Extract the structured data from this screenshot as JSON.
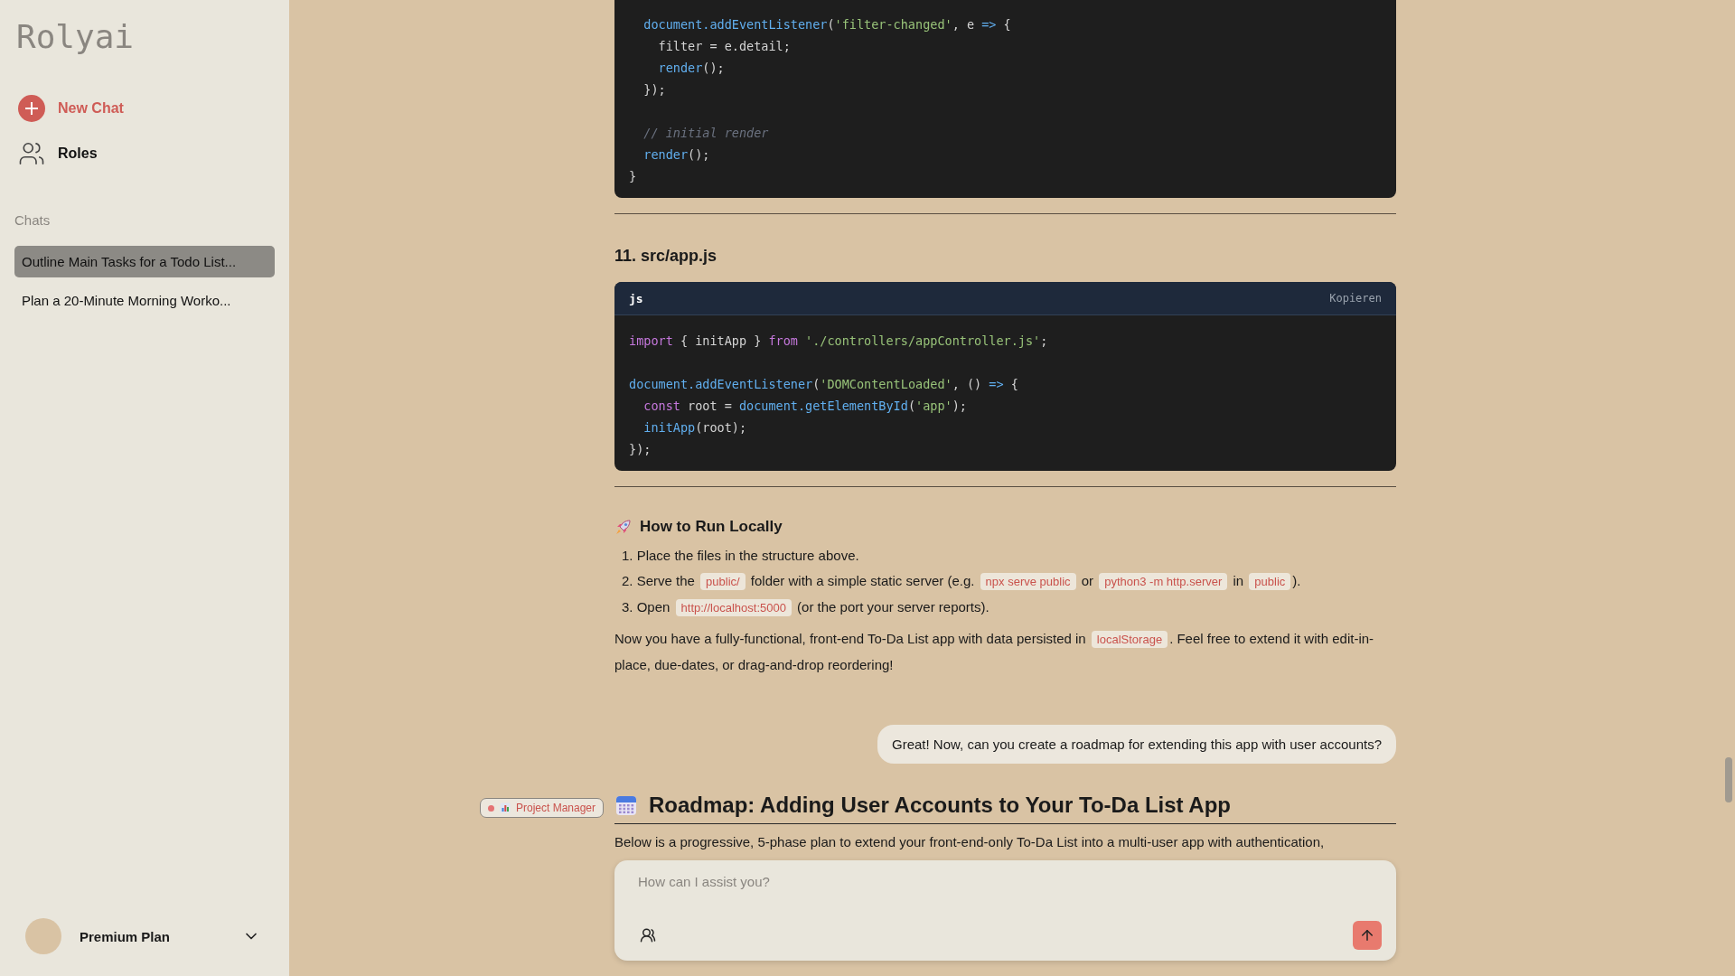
{
  "sidebar": {
    "logo": "Rolyai",
    "actions": [
      {
        "kind": "new_chat",
        "label": "New Chat"
      },
      {
        "kind": "roles",
        "label": "Roles"
      }
    ],
    "section_label": "Chats",
    "chats": [
      {
        "title": "Outline Main Tasks for a Todo List...",
        "selected": true
      },
      {
        "title": "Plan a 20-Minute Morning Worko...",
        "selected": false
      }
    ],
    "account": {
      "plan": "Premium Plan"
    }
  },
  "content": [
    {
      "kind": "code",
      "chunks": [
        {
          "lines": [
            [
              {
                "kind": "func",
                "text": "  document.addEventListener"
              },
              {
                "kind": "plain",
                "text": "("
              },
              {
                "kind": "string",
                "text": "'filter-changed'"
              },
              {
                "kind": "plain",
                "text": ", e "
              },
              {
                "kind": "func",
                "text": "=>"
              },
              {
                "kind": "plain",
                "text": " {"
              }
            ],
            [
              {
                "kind": "plain",
                "text": "    filter = e.detail;"
              }
            ],
            [
              {
                "kind": "func",
                "text": "    render"
              },
              {
                "kind": "plain",
                "text": "();"
              }
            ],
            [
              {
                "kind": "plain",
                "text": "  });"
              }
            ]
          ]
        },
        {
          "lines": [
            [
              {
                "kind": "comment",
                "text": "  // initial render"
              }
            ],
            [
              {
                "kind": "func",
                "text": "  render"
              },
              {
                "kind": "plain",
                "text": "();"
              }
            ],
            [
              {
                "kind": "plain",
                "text": "}"
              }
            ]
          ]
        }
      ]
    },
    {
      "kind": "rule"
    },
    {
      "kind": "file_heading",
      "text": "11. src/app.js"
    },
    {
      "kind": "code",
      "language": "js",
      "copy_label": "Kopieren",
      "chunks": [
        {
          "lines": [
            [
              {
                "kind": "keyword",
                "text": "import"
              },
              {
                "kind": "plain",
                "text": " { initApp } "
              },
              {
                "kind": "keyword",
                "text": "from "
              },
              {
                "kind": "string",
                "text": "'./controllers/appController.js'"
              },
              {
                "kind": "plain",
                "text": ";"
              }
            ]
          ]
        },
        {
          "lines": [
            [
              {
                "kind": "func",
                "text": "document.addEventListener"
              },
              {
                "kind": "plain",
                "text": "("
              },
              {
                "kind": "string",
                "text": "'DOMContentLoaded'"
              },
              {
                "kind": "plain",
                "text": ", () "
              },
              {
                "kind": "func",
                "text": "=>"
              },
              {
                "kind": "plain",
                "text": " {"
              }
            ],
            [
              {
                "kind": "keyword",
                "text": "  const"
              },
              {
                "kind": "plain",
                "text": " root = "
              },
              {
                "kind": "func",
                "text": "document.getElementById"
              },
              {
                "kind": "plain",
                "text": "("
              },
              {
                "kind": "string",
                "text": "'app'"
              },
              {
                "kind": "plain",
                "text": ");"
              }
            ],
            [
              {
                "kind": "func",
                "text": "  initApp"
              },
              {
                "kind": "plain",
                "text": "(root);"
              }
            ],
            [
              {
                "kind": "plain",
                "text": "});"
              }
            ]
          ]
        }
      ]
    },
    {
      "kind": "rule"
    },
    {
      "kind": "section_heading",
      "text": "How to Run Locally"
    },
    {
      "kind": "list",
      "items": [
        {
          "number": "1.",
          "parts": [
            {
              "kind": "text",
              "text": "Place the files in the structure above."
            }
          ]
        },
        {
          "number": "2.",
          "parts": [
            {
              "kind": "text",
              "text": "Serve the "
            },
            {
              "kind": "code",
              "text": "public/"
            },
            {
              "kind": "text",
              "text": " folder with a simple static server (e.g. "
            },
            {
              "kind": "code",
              "text": "npx serve public"
            },
            {
              "kind": "text",
              "text": " or "
            },
            {
              "kind": "code",
              "text": "python3 -m http.server"
            },
            {
              "kind": "text",
              "text": " in "
            },
            {
              "kind": "code",
              "text": "public"
            },
            {
              "kind": "text",
              "text": ")."
            }
          ]
        },
        {
          "number": "3.",
          "parts": [
            {
              "kind": "text",
              "text": "Open "
            },
            {
              "kind": "code",
              "text": "http://localhost:5000"
            },
            {
              "kind": "text",
              "text": " (or the port your server reports)."
            }
          ]
        }
      ]
    },
    {
      "kind": "paragraph",
      "parts": [
        {
          "kind": "text",
          "text": "Now you have a fully-functional, front-end To-Da List app with data persisted in "
        },
        {
          "kind": "code",
          "text": "localStorage"
        },
        {
          "kind": "text",
          "text": ". Feel free to extend it with edit-in-place, due-dates, or drag-and-drop reordering!"
        }
      ]
    },
    {
      "kind": "user_message",
      "text": "Great! Now, can you create a roadmap for extending this app with user accounts?"
    },
    {
      "kind": "answer_heading",
      "role": "Project Manager",
      "text": "Roadmap: Adding User Accounts to Your To-Da List App"
    },
    {
      "kind": "paragraph",
      "parts": [
        {
          "kind": "text",
          "text": "Below is a progressive, 5-phase plan to extend your front-end-only To-Da List into a multi-user app with authentication,"
        }
      ]
    }
  ],
  "composer": {
    "placeholder": "How can I assist you?"
  }
}
